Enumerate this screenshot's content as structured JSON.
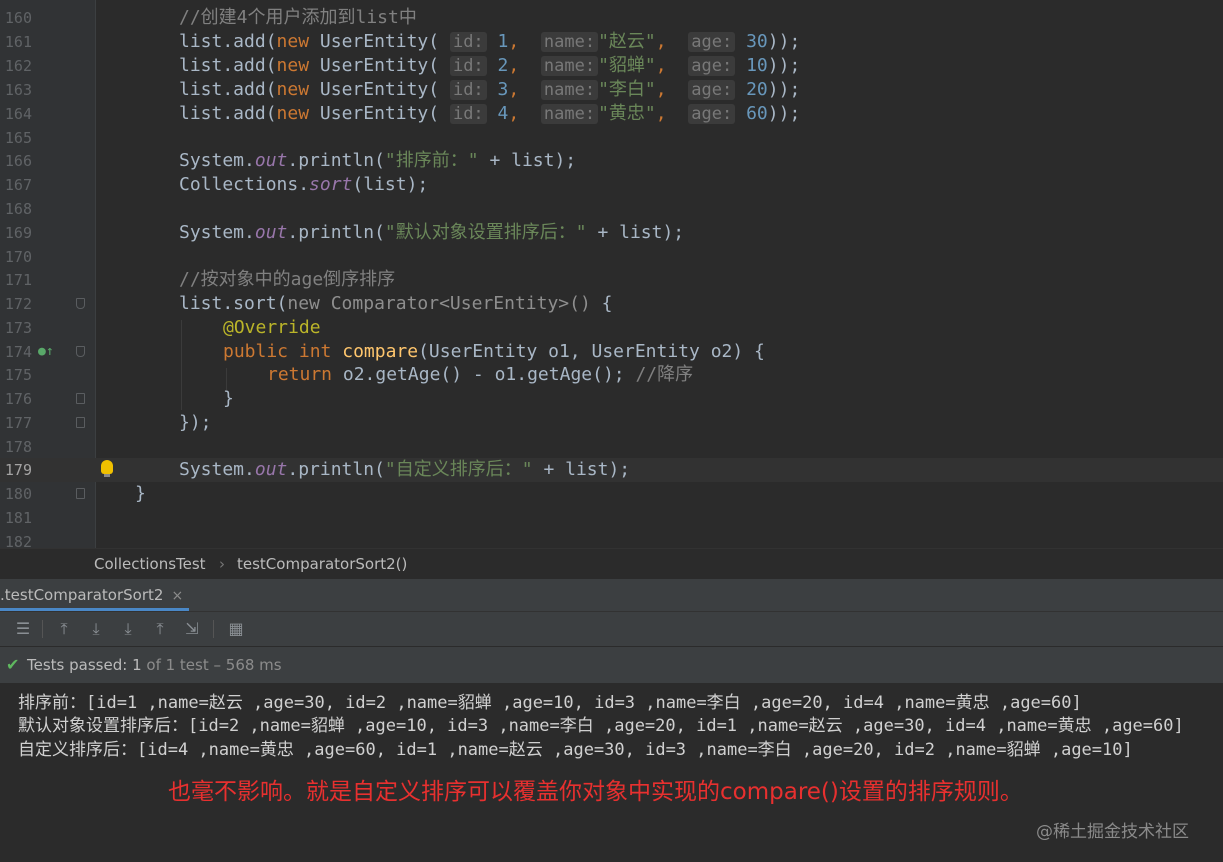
{
  "editor": {
    "line_numbers": [
      "160",
      "161",
      "162",
      "163",
      "164",
      "165",
      "166",
      "167",
      "168",
      "169",
      "170",
      "171",
      "172",
      "173",
      "174",
      "175",
      "176",
      "177",
      "178",
      "179",
      "180",
      "181",
      "182"
    ],
    "code": {
      "l160": "//创建4个用户添加到list中",
      "l161": [
        "list.add(",
        "new",
        " UserEntity(",
        "id:",
        "1",
        ", ",
        "name:",
        "\"赵云\"",
        ", ",
        "age:",
        "30",
        "));"
      ],
      "l162": [
        "list.add(",
        "new",
        " UserEntity(",
        "id:",
        "2",
        ", ",
        "name:",
        "\"貂蝉\"",
        ", ",
        "age:",
        "10",
        "));"
      ],
      "l163": [
        "list.add(",
        "new",
        " UserEntity(",
        "id:",
        "3",
        ", ",
        "name:",
        "\"李白\"",
        ", ",
        "age:",
        "20",
        "));"
      ],
      "l164": [
        "list.add(",
        "new",
        " UserEntity(",
        "id:",
        "4",
        ", ",
        "name:",
        "\"黄忠\"",
        ", ",
        "age:",
        "60",
        "));"
      ],
      "l166": [
        "System.",
        "out",
        ".println(",
        "\"排序前：\"",
        " + list);"
      ],
      "l167": [
        "Collections.",
        "sort",
        "(list);"
      ],
      "l169": [
        "System.",
        "out",
        ".println(",
        "\"默认对象设置排序后：\"",
        " + list);"
      ],
      "l171": "//按对象中的age倒序排序",
      "l172": [
        "list.sort(",
        "new Comparator<UserEntity>() ",
        "{"
      ],
      "l173": "@Override",
      "l174": [
        "public",
        " ",
        "int",
        " ",
        "compare",
        "(UserEntity o1, UserEntity o2) {"
      ],
      "l175": [
        "return",
        " o2.getAge() - o1.getAge(); ",
        "//降序"
      ],
      "l176": "}",
      "l177": "});",
      "l179": [
        "System.",
        "out",
        ".println(",
        "\"自定义排序后：\"",
        " + list);"
      ],
      "l180": "}"
    },
    "current_line": "179"
  },
  "breadcrumb": {
    "class": "CollectionsTest",
    "separator": "›",
    "method": "testComparatorSort2()"
  },
  "run_tab": {
    "label": ".testComparatorSort2",
    "close": "×"
  },
  "toolbar_icons": [
    "rerun-icon",
    "toggle-passed-icon",
    "sort-alpha-icon",
    "sort-duration-icon",
    "import-icon",
    "export-icon",
    "collapse-icon",
    "settings-icon"
  ],
  "status": {
    "label": "Tests passed:",
    "count": "1",
    "detail": "of 1 test – 568 ms"
  },
  "console": {
    "lines": [
      "排序前：[id=1 ,name=赵云 ,age=30, id=2 ,name=貂蝉 ,age=10, id=3 ,name=李白 ,age=20, id=4 ,name=黄忠 ,age=60]",
      "默认对象设置排序后：[id=2 ,name=貂蝉 ,age=10, id=3 ,name=李白 ,age=20, id=1 ,name=赵云 ,age=30, id=4 ,name=黄忠 ,age=60]",
      "自定义排序后：[id=4 ,name=黄忠 ,age=60, id=1 ,name=赵云 ,age=30, id=3 ,name=李白 ,age=20, id=2 ,name=貂蝉 ,age=10]"
    ],
    "annotation": "也毫不影响。就是自定义排序可以覆盖你对象中实现的compare()设置的排序规则。",
    "watermark": "@稀土掘金技术社区"
  },
  "colors": {
    "keyword": "#cc7832",
    "string": "#6a8759",
    "number": "#6897bb",
    "comment": "#808080",
    "annotation_red": "#e8302f"
  }
}
